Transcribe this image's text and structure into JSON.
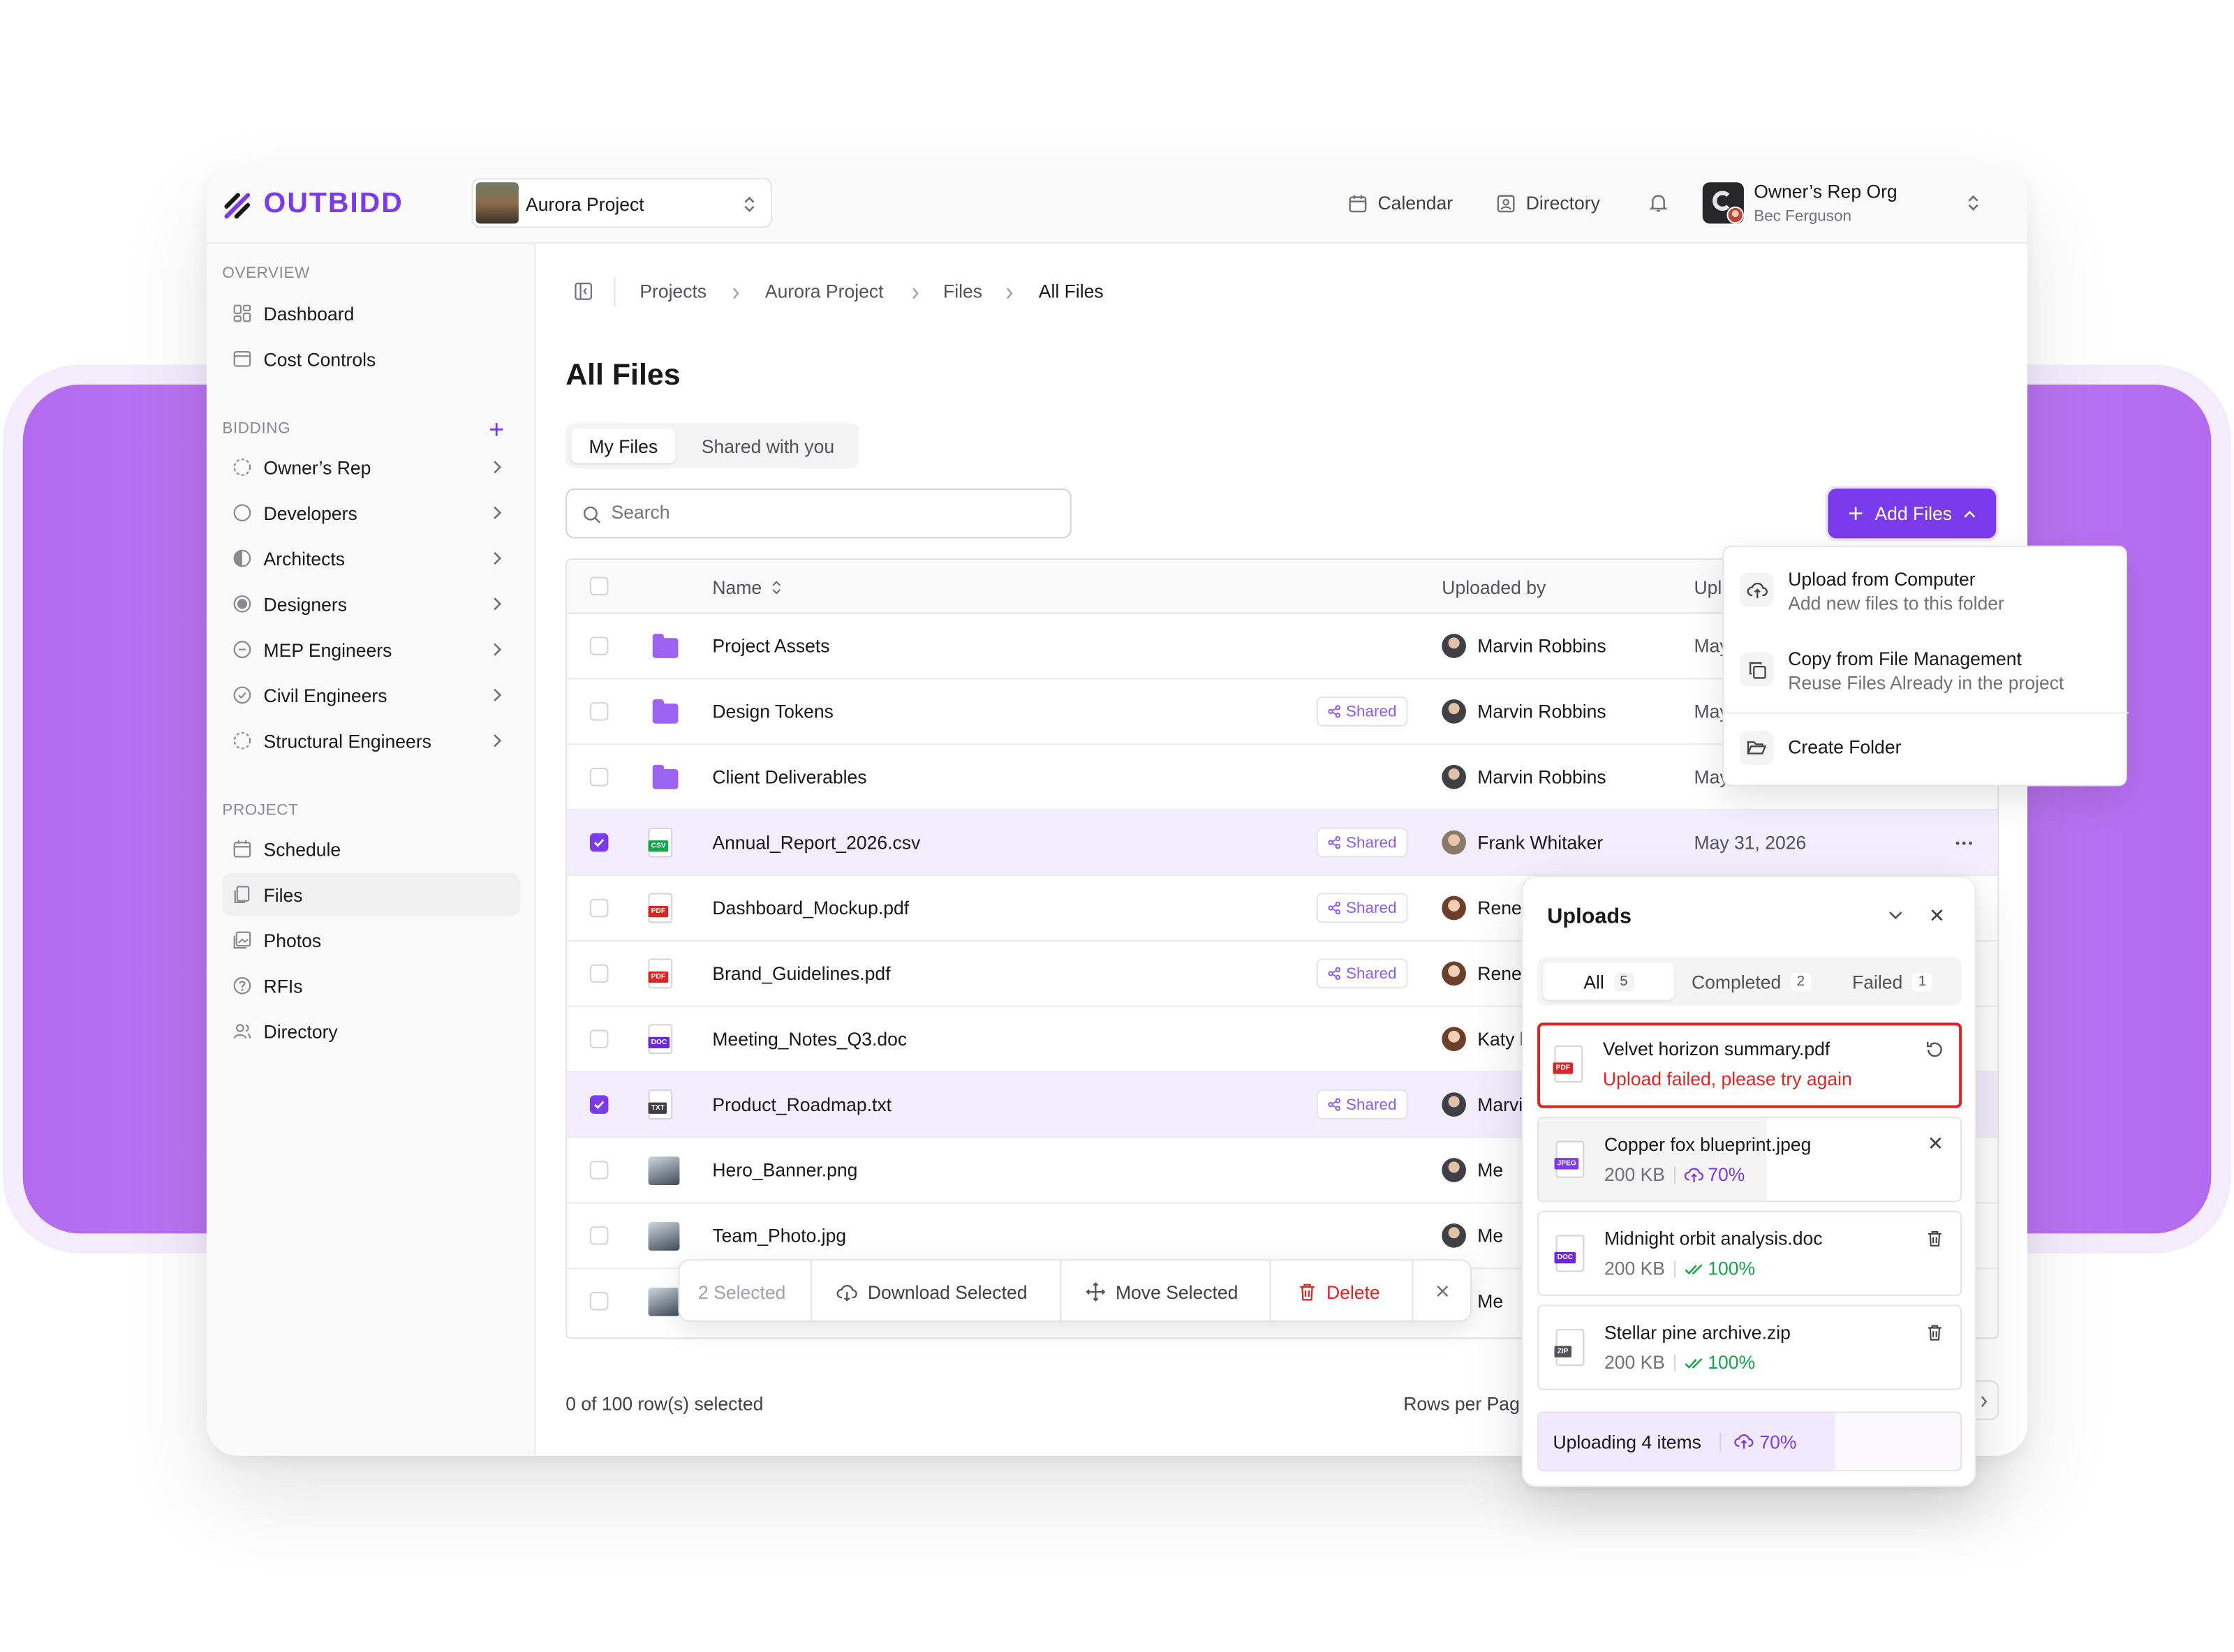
{
  "brand": {
    "name": "OUTBIDD"
  },
  "project_selector": {
    "name": "Aurora Project"
  },
  "topnav": {
    "calendar": "Calendar",
    "directory": "Directory"
  },
  "account": {
    "org": "Owner’s Rep Org",
    "user": "Bec Ferguson"
  },
  "sidebar": {
    "overview_label": "OVERVIEW",
    "overview": [
      {
        "label": "Dashboard"
      },
      {
        "label": "Cost Controls"
      }
    ],
    "bidding_label": "BIDDING",
    "bidding": [
      {
        "label": "Owner’s Rep"
      },
      {
        "label": "Developers"
      },
      {
        "label": "Architects"
      },
      {
        "label": "Designers"
      },
      {
        "label": "MEP Engineers"
      },
      {
        "label": "Civil Engineers"
      },
      {
        "label": "Structural Engineers"
      }
    ],
    "project_label": "PROJECT",
    "project": [
      {
        "label": "Schedule"
      },
      {
        "label": "Files"
      },
      {
        "label": "Photos"
      },
      {
        "label": "RFIs"
      },
      {
        "label": "Directory"
      }
    ]
  },
  "breadcrumb": [
    "Projects",
    "Aurora Project",
    "Files",
    "All Files"
  ],
  "page_title": "All Files",
  "tabs": [
    {
      "label": "My Files"
    },
    {
      "label": "Shared with you"
    }
  ],
  "search": {
    "placeholder": "Search"
  },
  "add_files": {
    "label": "Add Files"
  },
  "add_menu": [
    {
      "title": "Upload from Computer",
      "subtitle": "Add new files to this folder"
    },
    {
      "title": "Copy from File Management",
      "subtitle": "Reuse Files Already in the project"
    },
    {
      "title": "Create Folder"
    }
  ],
  "table": {
    "col_name": "Name",
    "col_uploaded_by": "Uploaded by",
    "col_uploaded_partial": "Upl",
    "shared_label": "Shared",
    "rows": [
      {
        "name": "Project Assets",
        "shared": false,
        "uploader": "Marvin Robbins",
        "date": "May"
      },
      {
        "name": "Design Tokens",
        "shared": true,
        "uploader": "Marvin Robbins",
        "date": "May"
      },
      {
        "name": "Client Deliverables",
        "shared": false,
        "uploader": "Marvin Robbins",
        "date": "May"
      },
      {
        "name": "Annual_Report_2026.csv",
        "shared": true,
        "uploader": "Frank Whitaker",
        "date": "May 31, 2026",
        "selected": true
      },
      {
        "name": "Dashboard_Mockup.pdf",
        "shared": true,
        "uploader": "Rene"
      },
      {
        "name": "Brand_Guidelines.pdf",
        "shared": true,
        "uploader": "Rene"
      },
      {
        "name": "Meeting_Notes_Q3.doc",
        "shared": false,
        "uploader": "Katy l"
      },
      {
        "name": "Product_Roadmap.txt",
        "shared": true,
        "uploader": "Marvi",
        "selected": true
      },
      {
        "name": "Hero_Banner.png",
        "shared": false,
        "uploader": "Me"
      },
      {
        "name": "Team_Photo.jpg",
        "shared": false,
        "uploader": "Me"
      },
      {
        "name": "",
        "shared": false,
        "uploader": "Me"
      }
    ]
  },
  "footer": {
    "selection": "0 of 100 row(s) selected",
    "rows_per_page": "Rows per Pag"
  },
  "bulk_bar": {
    "count": "2 Selected",
    "download": "Download Selected",
    "move": "Move Selected",
    "delete": "Delete"
  },
  "uploads": {
    "title": "Uploads",
    "filters": [
      {
        "label": "All",
        "count": "5"
      },
      {
        "label": "Completed",
        "count": "2"
      },
      {
        "label": "Failed",
        "count": "1"
      }
    ],
    "items": [
      {
        "name": "Velvet horizon summary.pdf",
        "status": "Upload failed, please try again",
        "type": "PDF"
      },
      {
        "name": "Copper fox blueprint.jpeg",
        "size": "200 KB",
        "progress": "70%",
        "type": "JPEG"
      },
      {
        "name": "Midnight orbit analysis.doc",
        "size": "200 KB",
        "progress": "100%",
        "type": "DOC"
      },
      {
        "name": "Stellar pine archive.zip",
        "size": "200 KB",
        "progress": "100%",
        "type": "ZIP"
      }
    ],
    "summary": {
      "label": "Uploading 4 items",
      "progress": "70%"
    }
  },
  "colors": {
    "accent": "#7c3aed",
    "danger": "#dc2626",
    "success": "#16a34a"
  }
}
